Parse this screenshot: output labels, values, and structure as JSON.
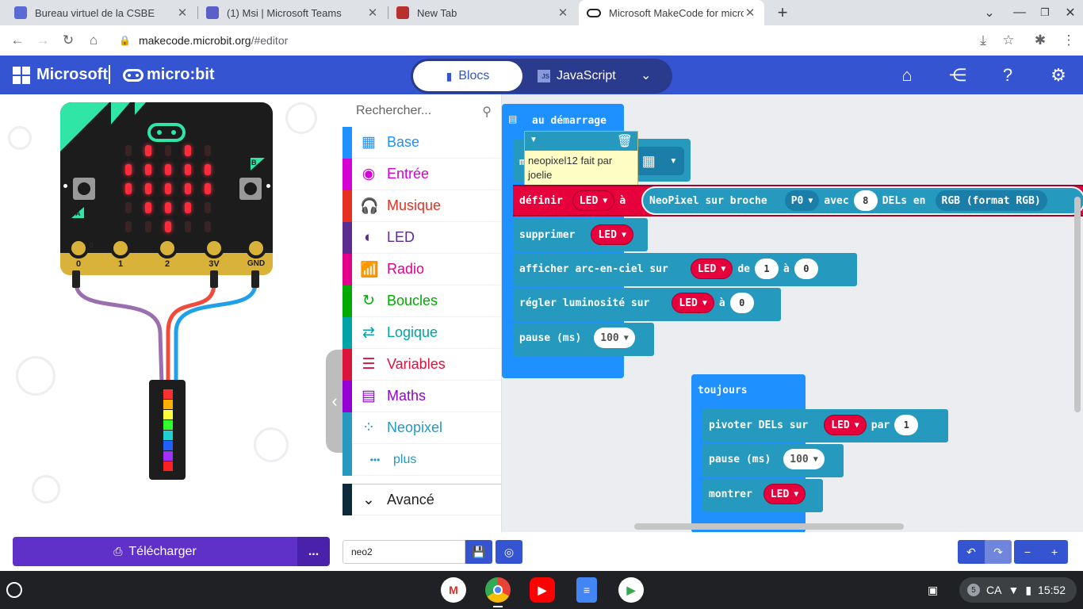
{
  "browser": {
    "tabs": [
      {
        "title": "Bureau virtuel de la CSBE",
        "fav": "#5b6bd6"
      },
      {
        "title": "(1) Msi | Microsoft Teams",
        "fav": "#5b5fc7"
      },
      {
        "title": "New Tab",
        "fav": "#b8312f"
      },
      {
        "title": "Microsoft MakeCode for micro:bit",
        "fav": "#222"
      }
    ],
    "new_tab": "+",
    "url_host": "makecode.microbit.org",
    "url_path": "/#editor"
  },
  "header": {
    "brand_ms": "Microsoft",
    "brand_microbit": "micro:bit",
    "mode_blocks": "Blocs",
    "mode_js": "JavaScript",
    "js_icon_text": "JS"
  },
  "simulator": {
    "pins": [
      "0",
      "1",
      "2",
      "3V",
      "GND"
    ],
    "button_a": "A",
    "button_b": "B",
    "pin0_tiny": "0",
    "led_on": [
      [
        0,
        1,
        0,
        1,
        0
      ],
      [
        1,
        1,
        1,
        1,
        1
      ],
      [
        1,
        1,
        1,
        1,
        1
      ],
      [
        0,
        1,
        1,
        1,
        0
      ],
      [
        0,
        0,
        1,
        0,
        0
      ]
    ],
    "strip_colors": [
      "#ff3030",
      "#ffb000",
      "#ffff40",
      "#30ff30",
      "#20d0d0",
      "#2060ff",
      "#a030ff",
      "#ff2020"
    ]
  },
  "toolbox": {
    "search_placeholder": "Rechercher...",
    "categories": [
      {
        "label": "Base",
        "color": "#1e90ff",
        "icon": "grid-icon",
        "glyph": "▦"
      },
      {
        "label": "Entrée",
        "color": "#d400d4",
        "icon": "target-icon",
        "glyph": "◉"
      },
      {
        "label": "Musique",
        "color": "#e63022",
        "icon": "headphones-icon",
        "glyph": "🎧"
      },
      {
        "label": "LED",
        "color": "#5c2d91",
        "icon": "toggle-icon",
        "glyph": "◐"
      },
      {
        "label": "Radio",
        "color": "#e3008c",
        "icon": "signal-icon",
        "glyph": "📶"
      },
      {
        "label": "Boucles",
        "color": "#00aa00",
        "icon": "refresh-icon",
        "glyph": "↻"
      },
      {
        "label": "Logique",
        "color": "#00a4a6",
        "icon": "shuffle-icon",
        "glyph": "⇄"
      },
      {
        "label": "Variables",
        "color": "#dc143c",
        "icon": "lines-icon",
        "glyph": "☰"
      },
      {
        "label": "Maths",
        "color": "#9400d3",
        "icon": "calculator-icon",
        "glyph": "▤"
      },
      {
        "label": "Neopixel",
        "color": "#2699bf",
        "icon": "spinner-icon",
        "glyph": "⁘"
      },
      {
        "label": "plus",
        "color": "#2699bf",
        "icon": "dots-icon",
        "glyph": "•••"
      },
      {
        "label": "Avancé",
        "color": "#0d2a3a",
        "icon": "chevron-down-icon",
        "glyph": "⌄"
      }
    ]
  },
  "workspace": {
    "on_start": "au démarrage",
    "comment_text": "neopixel12 fait par joelie",
    "definir": "définir",
    "led_var": "LED",
    "a": "à",
    "neopixel_on_pin": "NeoPixel sur broche",
    "pin_value": "P0",
    "with": "avec",
    "led_count": "8",
    "dels_en": "DELs en",
    "format": "RGB (format RGB)",
    "clear": "supprimer",
    "show_rainbow": "afficher arc-en-ciel sur",
    "de": "de",
    "rainbow_from": "1",
    "rainbow_to": "0",
    "set_brightness": "régler luminosité sur",
    "brightness": "0",
    "pause": "pause (ms)",
    "pause_value": "100",
    "forever": "toujours",
    "rotate": "pivoter DELs sur",
    "par": "par",
    "rotate_by": "1",
    "pause2_value": "100",
    "show": "montrer"
  },
  "bottom": {
    "download": "Télécharger",
    "more": "...",
    "project_name": "neo2"
  },
  "shelf": {
    "notif_count": "5",
    "locale": "CA",
    "time": "15:52"
  }
}
